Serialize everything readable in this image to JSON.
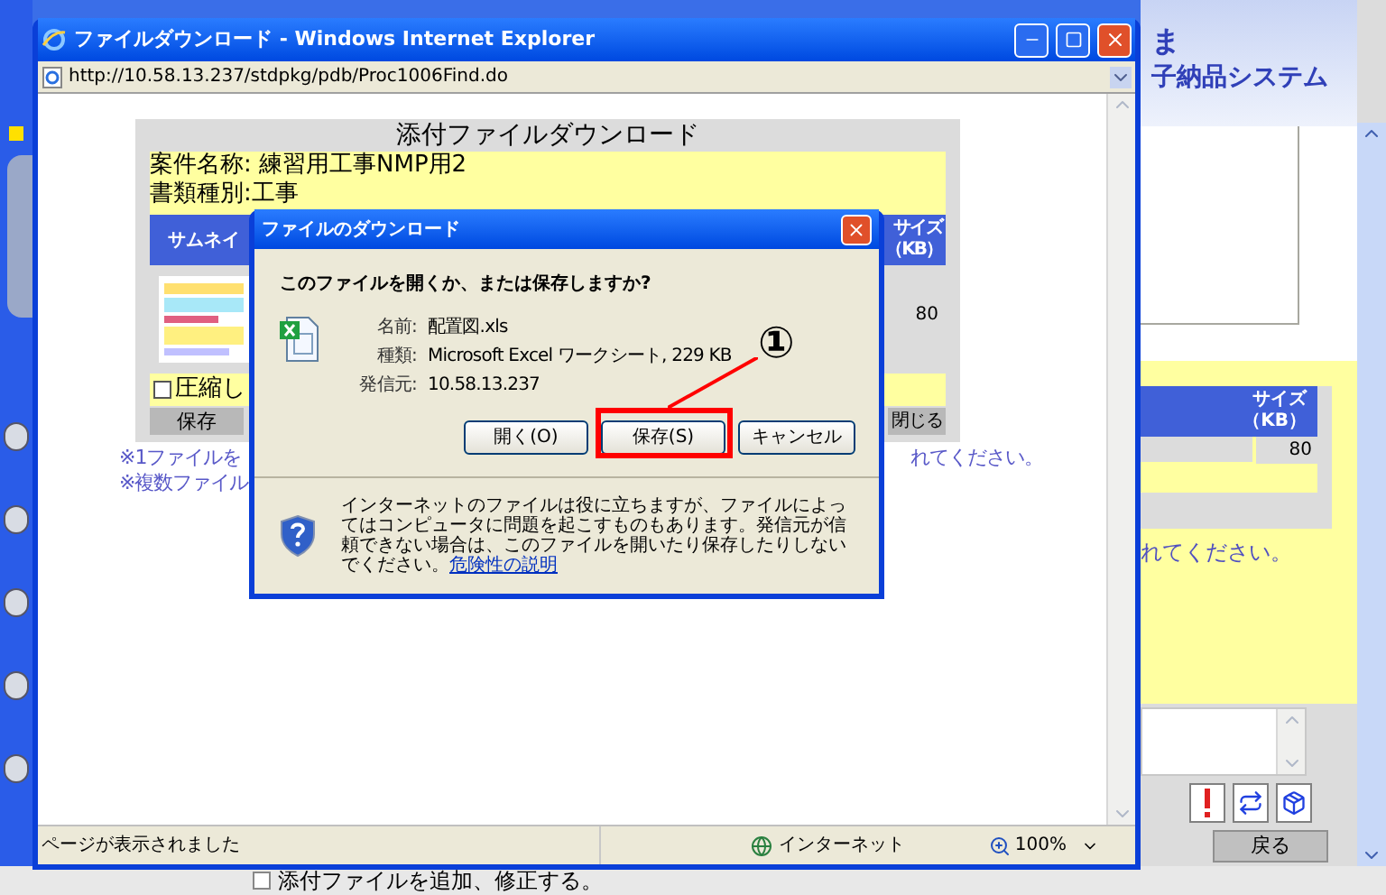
{
  "background_page": {
    "logo_lines": [
      "ま",
      "子納品システム"
    ],
    "size_header": [
      "サイズ",
      "（KB）"
    ],
    "size_value": "80",
    "note": "れてください。",
    "footer_checked": false,
    "back_button": "戻る",
    "footer_text": "添付ファイルを追加、修正する。"
  },
  "ie_window": {
    "title": "ファイルダウンロード - Windows Internet Explorer",
    "url": "http://10.58.13.237/stdpkg/pdb/Proc1006Find.do",
    "status": "ページが表示されました",
    "zone": "インターネット",
    "zoom": "100%"
  },
  "page": {
    "title": "添付ファイルダウンロード",
    "project_line": "案件名称: 練習用工事NMP用2",
    "doc_type_line": "書類種別:工事",
    "column_1": "サムネイ",
    "size_header": [
      "サイズ",
      "（KB）"
    ],
    "size_value": "80",
    "compress_label": "圧縮し",
    "compress_checked": false,
    "save_button": "保存",
    "close_button": "閉じる",
    "notes": [
      "※1ファイルを",
      "※複数ファイル"
    ],
    "note_tail": "れてください。"
  },
  "dialog": {
    "title": "ファイルのダウンロード",
    "question": "このファイルを開くか、または保存しますか?",
    "fields": [
      {
        "label": "名前:",
        "value": "配置図.xls"
      },
      {
        "label": "種類:",
        "value": "Microsoft Excel ワークシート, 229 KB"
      },
      {
        "label": "発信元:",
        "value": "10.58.13.237"
      }
    ],
    "buttons": [
      "開く(O)",
      "保存(S)",
      "キャンセル"
    ],
    "warning": "インターネットのファイルは役に立ちますが、ファイルによってはコンピュータに問題を起こすものもあります。発信元が信頼できない場合は、このファイルを開いたり保存したりしないでください。",
    "warning_link": "危険性の説明"
  },
  "annotation": {
    "label": "①"
  }
}
